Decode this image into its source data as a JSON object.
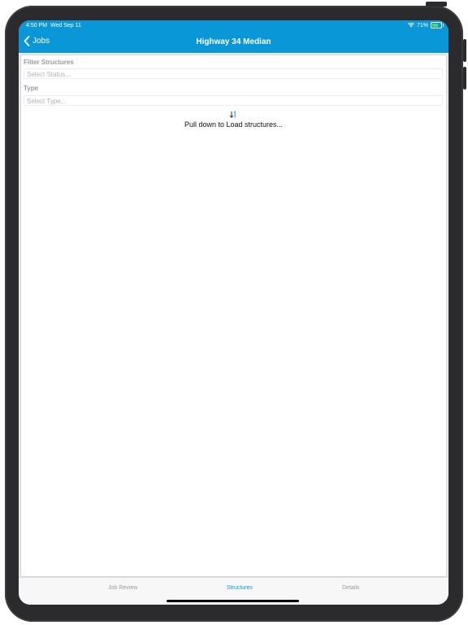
{
  "status_bar": {
    "time": "4:50 PM",
    "date": "Wed Sep 11",
    "battery": "71%",
    "battery_level": 0.71
  },
  "nav": {
    "back_label": "Jobs",
    "title": "Highway 34 Median"
  },
  "filters": {
    "filter_label": "Filter Structures",
    "status_placeholder": "Select Status...",
    "type_label": "Type",
    "type_placeholder": "Select Type..."
  },
  "empty_state": {
    "icon": "sort-down-icon",
    "message": "Pull down to Load structures..."
  },
  "tabs": [
    {
      "label": "Job Review",
      "active": false
    },
    {
      "label": "Structures",
      "active": true
    },
    {
      "label": "Details",
      "active": false
    }
  ],
  "colors": {
    "accent": "#0a97d8",
    "inactive_tab": "#9a9aa0",
    "battery_fill": "#4cd964"
  }
}
